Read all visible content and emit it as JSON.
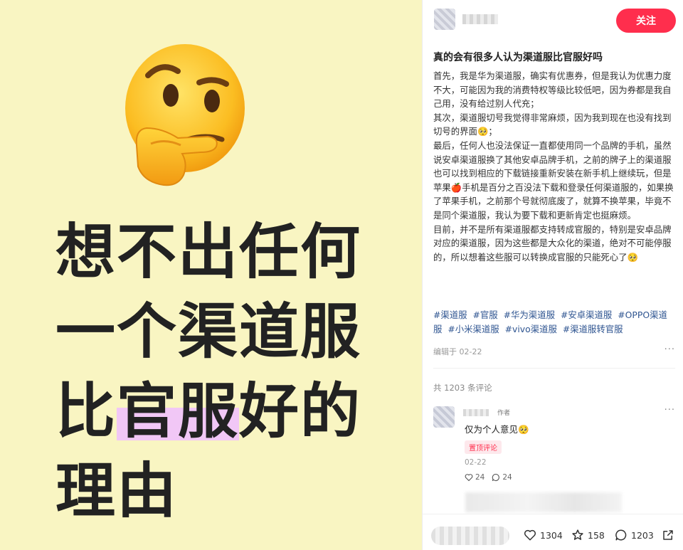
{
  "cover": {
    "lines": [
      "想不出任何",
      "一个渠道服"
    ],
    "line3_pre": "比",
    "line3_highlight": "官服",
    "line3_post": "好的",
    "line4": "理由"
  },
  "header": {
    "follow_label": "关注"
  },
  "post": {
    "title": "真的会有很多人认为渠道服比官服好吗",
    "paragraphs": [
      "首先，我是华为渠道服，确实有优惠券，但是我认为优惠力度不大，可能因为我的消费特权等级比较低吧，因为券都是我自己用，没有给过别人代充；",
      "其次，渠道服切号我觉得非常麻烦，因为我到现在也没有找到切号的界面🥺；",
      "最后，任何人也没法保证一直都使用同一个品牌的手机，虽然说安卓渠道服换了其他安卓品牌手机，之前的牌子上的渠道服也可以找到相应的下载链接重新安装在新手机上继续玩，但是苹果🍎手机是百分之百没法下载和登录任何渠道服的，如果换了苹果手机，之前那个号就彻底废了，就算不换苹果，毕竟不是同个渠道服，我认为要下载和更新肯定也挺麻烦。",
      "目前，并不是所有渠道服都支持转成官服的，特别是安卓品牌对应的渠道服，因为这些都是大众化的渠道，绝对不可能停服的，所以想着这些服可以转换成官服的只能死心了🥺"
    ],
    "tags": [
      "#渠道服",
      "#官服",
      "#华为渠道服",
      "#安卓渠道服",
      "#OPPO渠道服",
      "#小米渠道服",
      "#vivo渠道服",
      "#渠道服转官服"
    ],
    "edited": "编辑于 02-22",
    "more": "···"
  },
  "comments": {
    "count_label": "共 1203 条评论",
    "items": [
      {
        "author_tag": "作者",
        "text": "仅为个人意见🥺",
        "pinned": "置顶评论",
        "date": "02-22",
        "likes": "24",
        "replies": "24",
        "more": "···"
      }
    ]
  },
  "bottom_bar": {
    "likes": "1304",
    "stars": "158",
    "comments": "1203"
  },
  "colors": {
    "cover_bg": "#f9f5c2",
    "highlight": "#f1c7f6",
    "accent": "#ff2e4d",
    "tag": "#2f5591"
  },
  "icons": {
    "emoji": "thinking-face-icon",
    "like": "heart-icon",
    "star": "star-icon",
    "comment": "comment-bubble-icon",
    "share": "share-icon"
  }
}
